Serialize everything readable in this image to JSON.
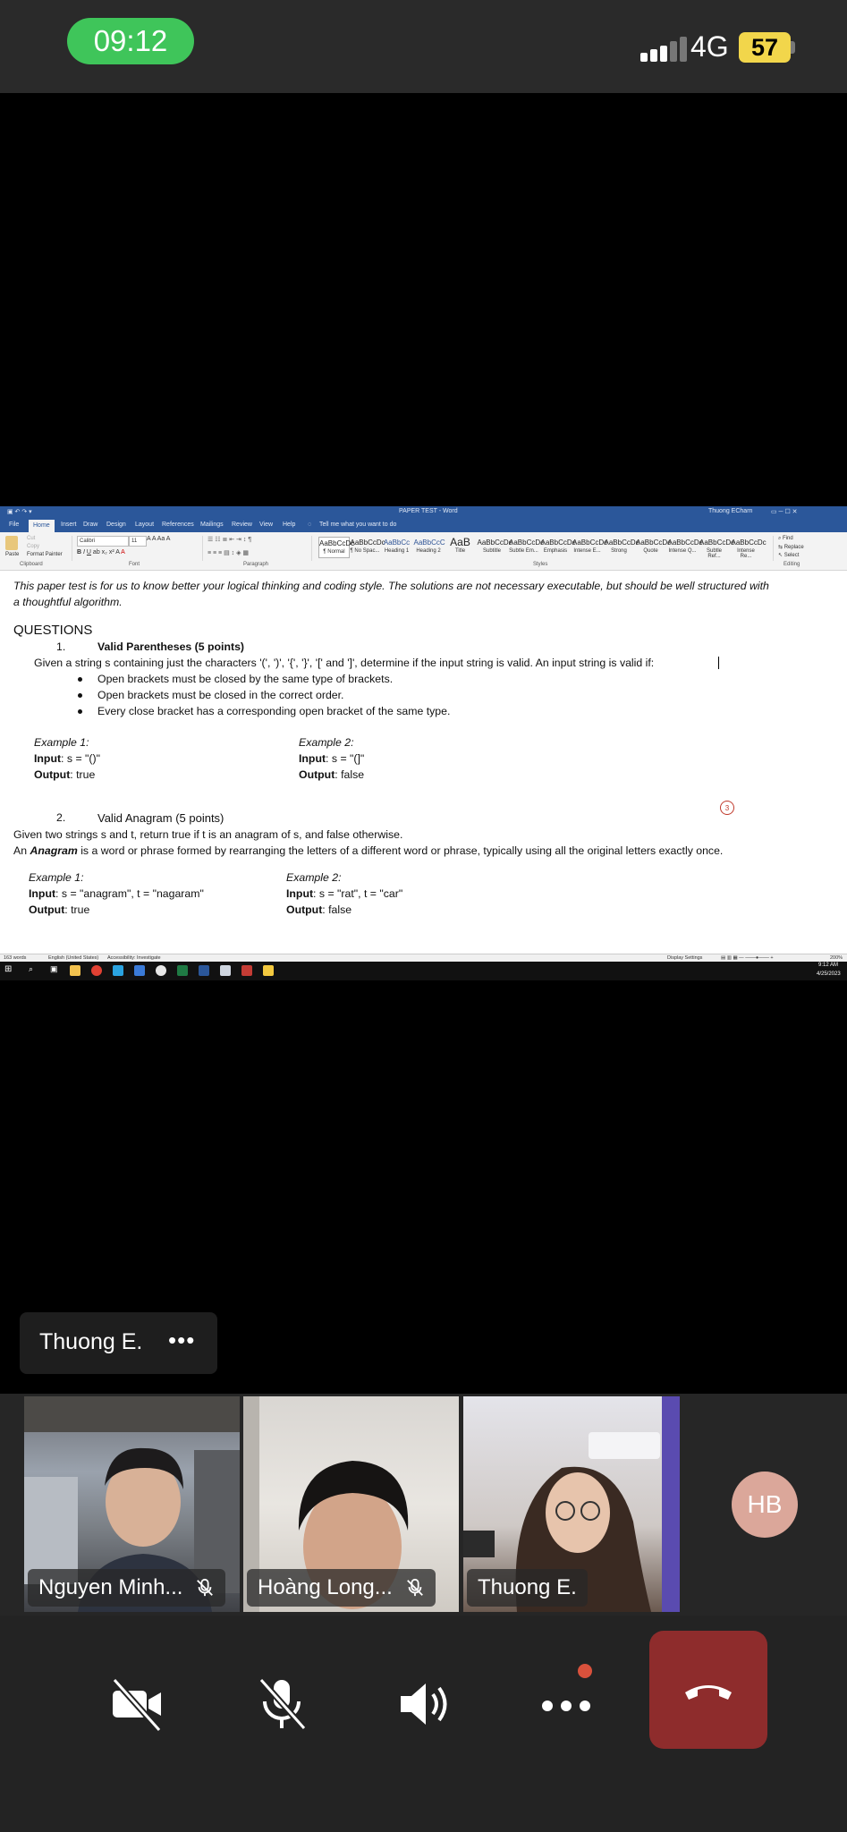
{
  "status_bar": {
    "time": "09:12",
    "network": "4G",
    "battery": "57"
  },
  "word": {
    "title": "PAPER TEST  -  Word",
    "user": "Thuong  ECharn",
    "tabs": [
      "File",
      "Home",
      "Insert",
      "Draw",
      "Design",
      "Layout",
      "References",
      "Mailings",
      "Review",
      "View",
      "Help",
      "Tell me what you want to do"
    ],
    "ribbon": {
      "clipboard": {
        "paste": "Paste",
        "cut": "Cut",
        "copy": "Copy",
        "format_painter": "Format Painter",
        "label": "Clipboard"
      },
      "font": {
        "name": "Calibri",
        "size": "11",
        "label": "Font"
      },
      "paragraph_label": "Paragraph",
      "styles": [
        {
          "preview": "AaBbCcDc",
          "name": "¶ Normal"
        },
        {
          "preview": "AaBbCcDc",
          "name": "¶ No Spac..."
        },
        {
          "preview": "AaBbCc",
          "name": "Heading 1"
        },
        {
          "preview": "AaBbCcC",
          "name": "Heading 2"
        },
        {
          "preview": "AaB",
          "name": "Title"
        },
        {
          "preview": "AaBbCcDc",
          "name": "Subtitle"
        },
        {
          "preview": "AaBbCcDc",
          "name": "Subtle Em..."
        },
        {
          "preview": "AaBbCcDc",
          "name": "Emphasis"
        },
        {
          "preview": "AaBbCcDc",
          "name": "Intense E..."
        },
        {
          "preview": "AaBbCcDc",
          "name": "Strong"
        },
        {
          "preview": "AaBbCcDc",
          "name": "Quote"
        },
        {
          "preview": "AaBbCcDc",
          "name": "Intense Q..."
        },
        {
          "preview": "AaBbCcDc",
          "name": "Subtle Ref..."
        },
        {
          "preview": "AaBbCcDc",
          "name": "Intense Re..."
        }
      ],
      "styles_label": "Styles",
      "editing": {
        "find": "Find",
        "replace": "Replace",
        "select": "Select",
        "label": "Editing"
      }
    },
    "document": {
      "intro_1": "This paper test is for us to know better your logical thinking and coding style. The solutions are not necessary executable, but should be well structured with",
      "intro_2": "a thoughtful algorithm.",
      "heading": "QUESTIONS",
      "q1": {
        "number": "1.",
        "title": "Valid Parentheses (5 points)",
        "body": "Given a string s containing just the characters '(', ')', '{', '}', '[' and ']', determine if the input string is valid. An input string is valid if:",
        "bullets": [
          "Open brackets must be closed by the same type of brackets.",
          "Open brackets must be closed in the correct order.",
          "Every close bracket has a corresponding open bracket of the same type."
        ],
        "example1": {
          "label": "Example 1:",
          "input": "s = \"()\"",
          "output": "true"
        },
        "example2": {
          "label": "Example 2:",
          "input": "s = \"(]\"",
          "output": "false"
        }
      },
      "q2": {
        "number": "2.",
        "title": "Valid Anagram (5 points)",
        "line1": "Given two strings s and t, return true if t is an anagram of s, and false otherwise.",
        "line2_prefix": "An ",
        "line2_term": "Anagram",
        "line2_rest": " is a word or phrase formed by rearranging the letters of a different word or phrase, typically using all the original letters exactly once.",
        "example1": {
          "label": "Example 1:",
          "input": "s = \"anagram\", t = \"nagaram\"",
          "output": "true"
        },
        "example2": {
          "label": "Example 2:",
          "input": "s = \"rat\", t = \"car\"",
          "output": "false"
        }
      },
      "input_label": "Input",
      "output_label": "Output",
      "comment_badge": "3"
    },
    "statusbar": {
      "words": "163 words",
      "language": "English (United States)",
      "accessibility": "Accessibility: Investigate",
      "display": "Display Settings",
      "zoom": "200%"
    },
    "taskbar": {
      "time": "9:12 AM",
      "date": "4/25/2023"
    }
  },
  "meeting": {
    "active_speaker": "Thuong E.",
    "more": "•••",
    "participants": [
      {
        "name": "Nguyen Minh...",
        "muted": true
      },
      {
        "name": "Hoàng Long...",
        "muted": true
      },
      {
        "name": "Thuong E.",
        "muted": false
      }
    ],
    "avatar_initials": "HB"
  },
  "colors": {
    "word_blue": "#2b579a",
    "end_call": "#8e2c2c",
    "pill_green": "#3fc55a",
    "avatar": "#dba79a"
  }
}
